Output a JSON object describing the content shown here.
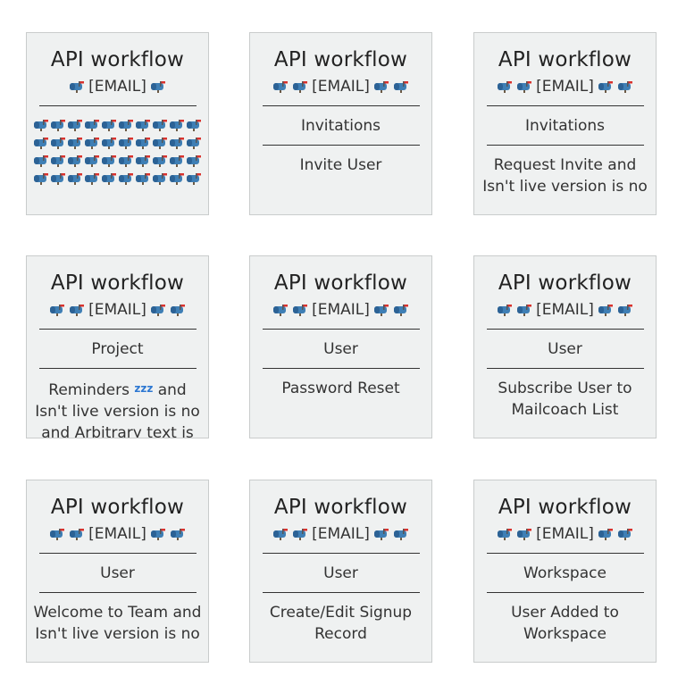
{
  "cards": [
    {
      "title": "API workflow",
      "email": "[EMAIL]",
      "mailbox_grid_count": 40
    },
    {
      "title": "API workflow",
      "email": "[EMAIL]",
      "category": "Invitations",
      "text": "Invite User"
    },
    {
      "title": "API workflow",
      "email": "[EMAIL]",
      "category": "Invitations",
      "text": "Request Invite and Isn't live version is no"
    },
    {
      "title": "API workflow",
      "email": "[EMAIL]",
      "category": "Project",
      "text_a": "Reminders",
      "text_zz": "zzz",
      "text_b": "and Isn't live version is no and Arbitrary text is NOT"
    },
    {
      "title": "API workflow",
      "email": "[EMAIL]",
      "category": "User",
      "text": "Password Reset"
    },
    {
      "title": "API workflow",
      "email": "[EMAIL]",
      "category": "User",
      "text": "Subscribe User to Mailcoach List"
    },
    {
      "title": "API workflow",
      "email": "[EMAIL]",
      "category": "User",
      "text": "Welcome to Team and Isn't live version is no"
    },
    {
      "title": "API workflow",
      "email": "[EMAIL]",
      "category": "User",
      "text": "Create/Edit Signup Record"
    },
    {
      "title": "API workflow",
      "email": "[EMAIL]",
      "category": "Workspace",
      "text": "User Added to Workspace"
    }
  ],
  "icons": {
    "mailbox": "mailbox-icon",
    "sleep": "zzz-icon"
  },
  "colors": {
    "card_bg": "#eff1f1",
    "card_border": "#c9cccc",
    "mailbox_blue": "#3f7fb5",
    "flag_red": "#d9322d"
  }
}
